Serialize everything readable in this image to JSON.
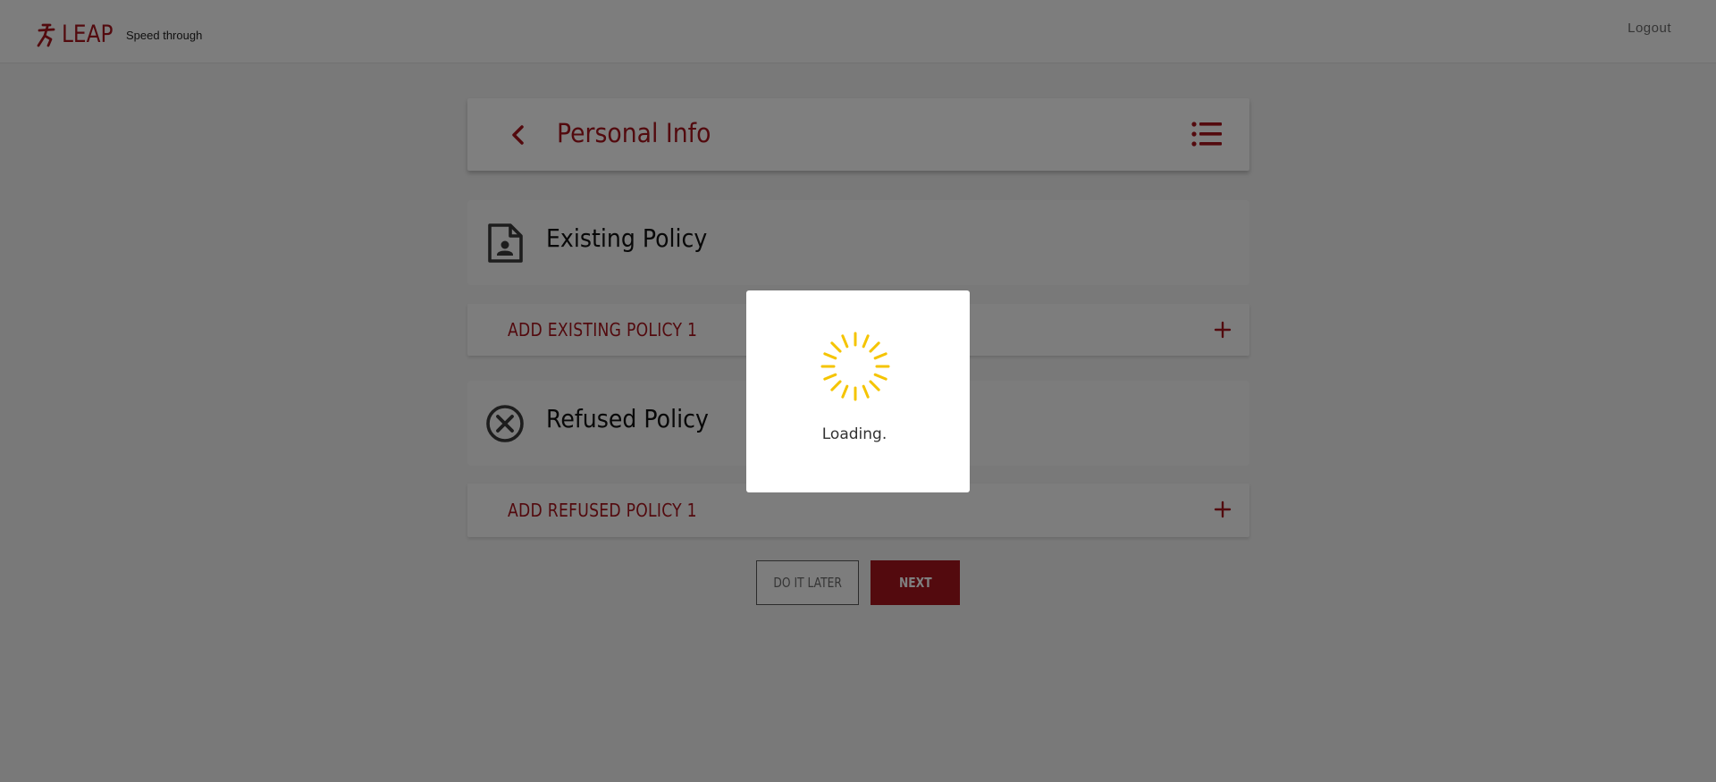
{
  "colors": {
    "brand": "#a6141d",
    "spinner": "#f5c400",
    "overlay": "rgba(0,0,0,0.5)"
  },
  "header": {
    "logo_text": "LEAP",
    "tagline": "Speed through",
    "logout_label": "Logout"
  },
  "title_bar": {
    "title": "Personal Info",
    "back_icon": "chevron-left-icon",
    "menu_icon": "list-icon"
  },
  "sections": {
    "existing": {
      "title": "Existing Policy",
      "icon": "contact-document-icon",
      "add_label": "ADD EXISTING POLICY 1"
    },
    "refused": {
      "title": "Refused Policy",
      "icon": "circle-x-icon",
      "add_label": "ADD REFUSED POLICY 1"
    }
  },
  "buttons": {
    "later_label": "DO IT LATER",
    "next_label": "NEXT"
  },
  "modal": {
    "loading_text": "Loading."
  }
}
